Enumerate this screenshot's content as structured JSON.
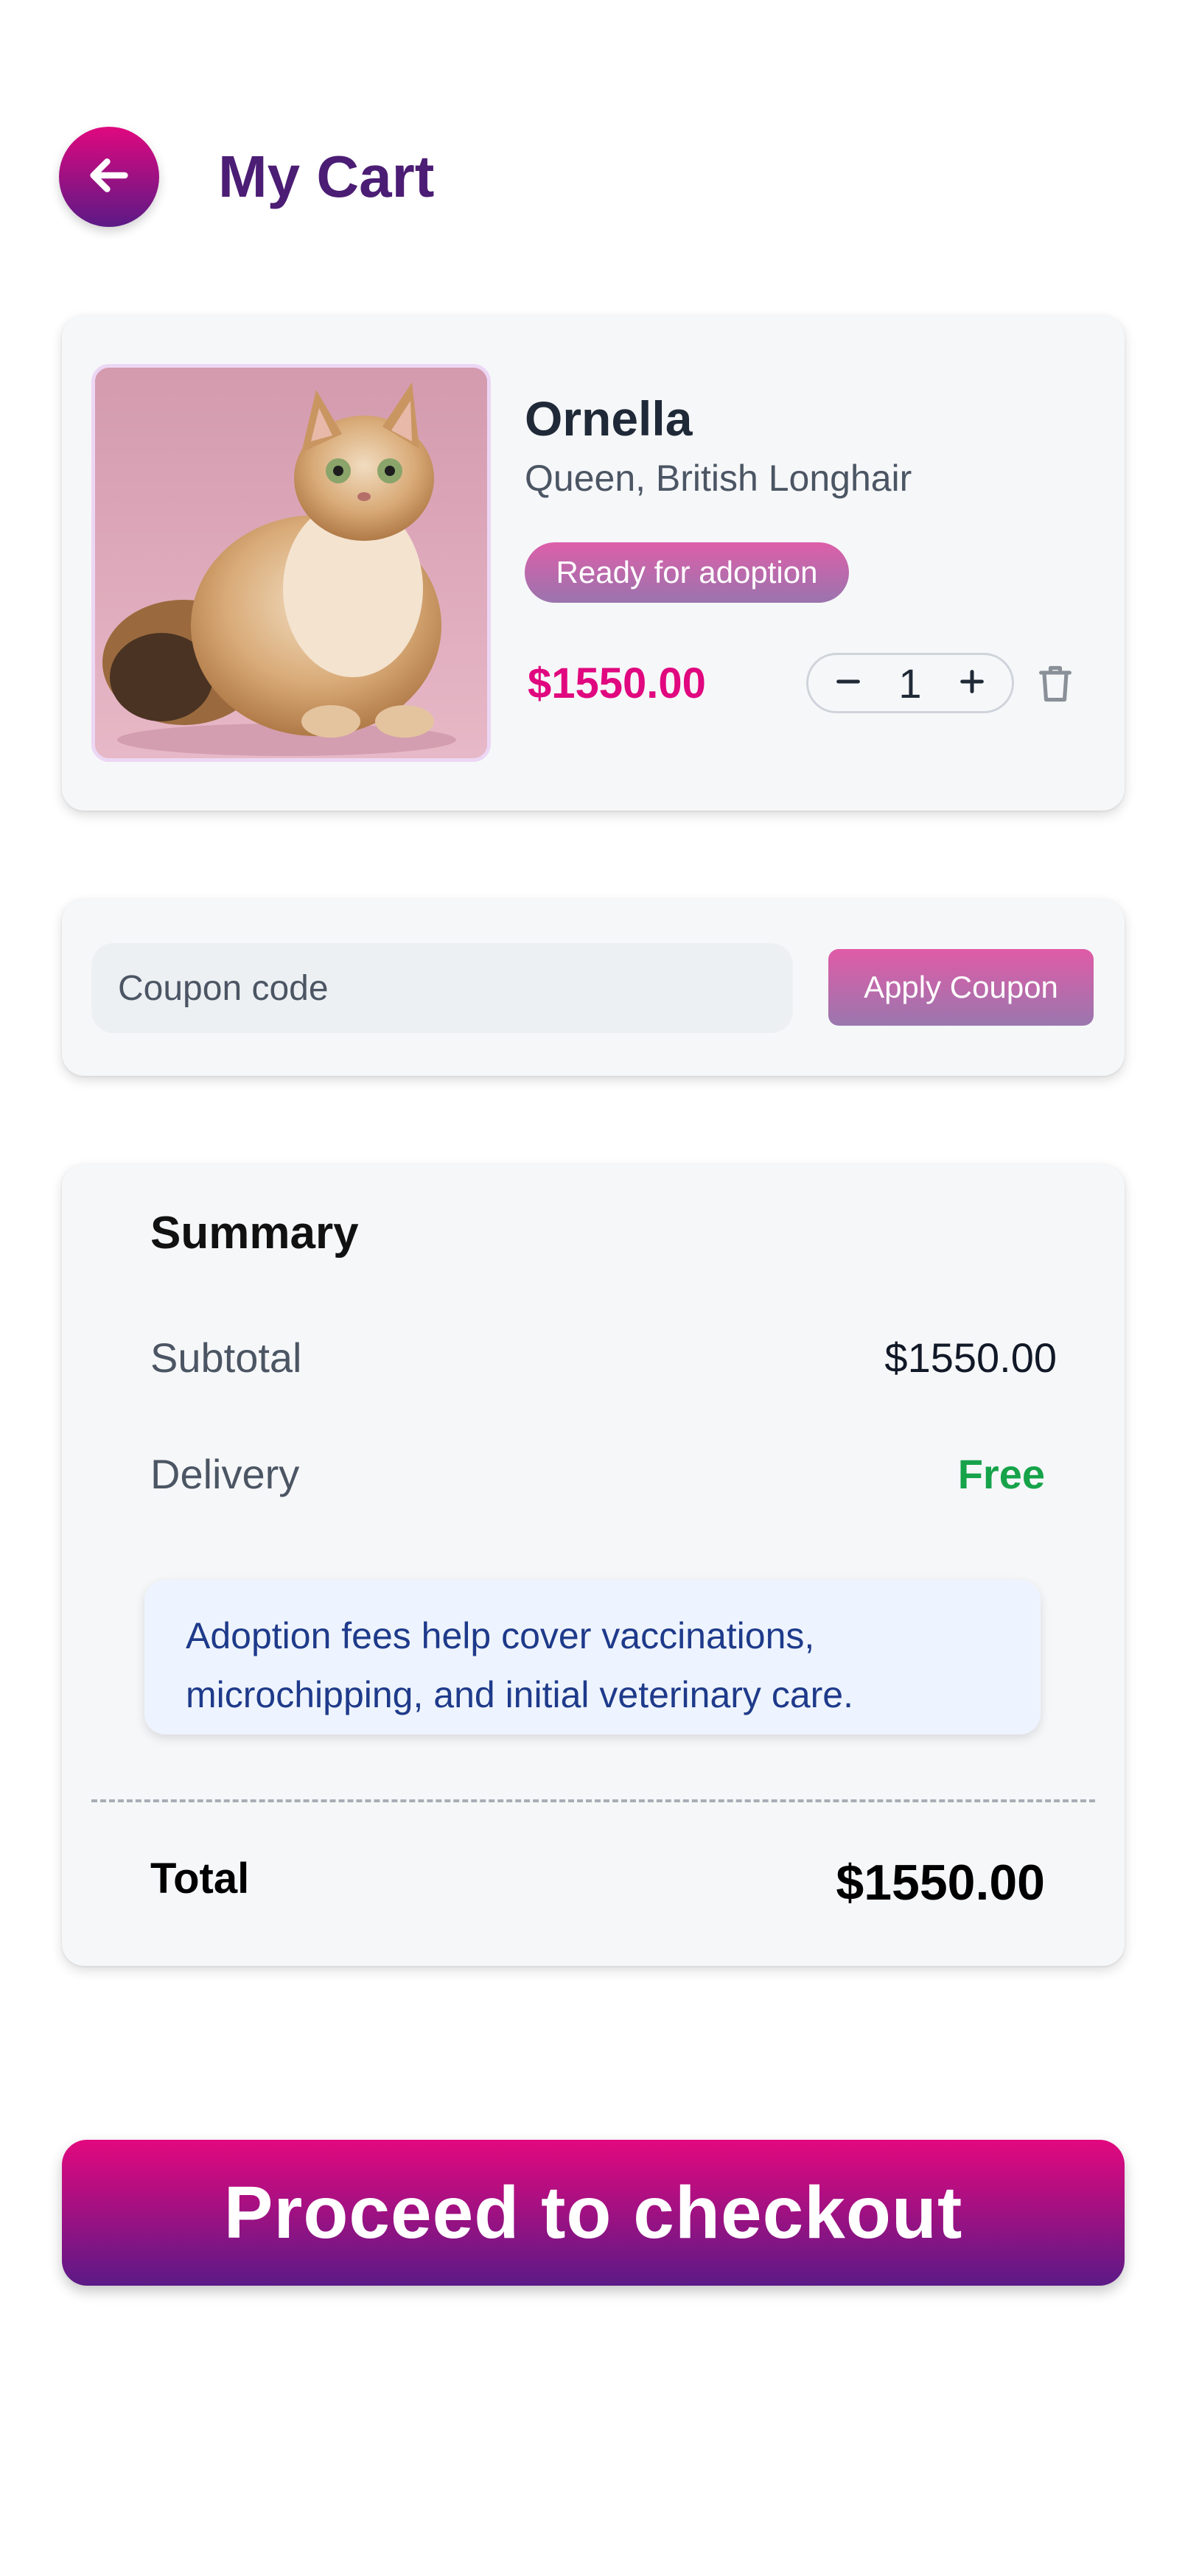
{
  "header": {
    "title": "My Cart",
    "back_icon": "arrow-left-icon"
  },
  "cart_item": {
    "image": "cat-photo",
    "name": "Ornella",
    "breed": "Queen, British Longhair",
    "status": "Ready for adoption",
    "price": "$1550.00",
    "quantity": "1",
    "decrease_icon": "minus-icon",
    "increase_icon": "plus-icon",
    "delete_icon": "trash-icon"
  },
  "coupon": {
    "placeholder": "Coupon code",
    "value": "",
    "apply_label": "Apply Coupon"
  },
  "summary": {
    "title": "Summary",
    "subtotal_label": "Subtotal",
    "subtotal_value": "$1550.00",
    "delivery_label": "Delivery",
    "delivery_value": "Free",
    "note": "Adoption fees help cover vaccinations, microchipping, and initial veterinary care.",
    "total_label": "Total",
    "total_value": "$1550.00"
  },
  "checkout": {
    "label": "Proceed to checkout"
  },
  "colors": {
    "accent_pink": "#e0077f",
    "accent_purple": "#5b1a86",
    "title_purple": "#4c1d74",
    "free_green": "#16a34a",
    "note_blue": "#1e3a8a"
  }
}
